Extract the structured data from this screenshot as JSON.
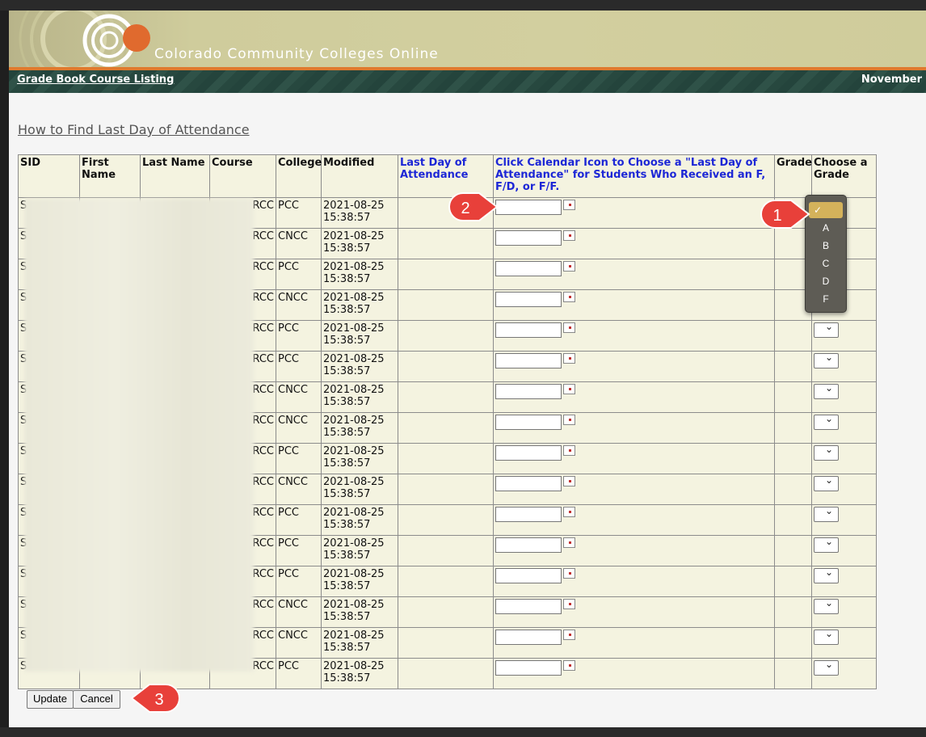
{
  "banner": {
    "site_title": "Colorado Community Colleges Online"
  },
  "nav": {
    "link": "Grade Book Course Listing",
    "date": "November"
  },
  "help_link": "How to Find Last Day of Attendance",
  "table": {
    "headers": [
      "SID",
      "First Name",
      "Last Name",
      "Course",
      "College",
      "Modified",
      "Last Day of Attendance",
      "Click Calendar Icon to Choose a \"Last Day of Attendance\" for Students Who Received an F, F/D, or F/F.",
      "Grade",
      "Choose a Grade"
    ],
    "rows": [
      {
        "sid": "S",
        "course": "RCC",
        "college": "PCC",
        "modified_date": "2021-08-25",
        "modified_time": "15:38:57"
      },
      {
        "sid": "S",
        "course": "RCC",
        "college": "CNCC",
        "modified_date": "2021-08-25",
        "modified_time": "15:38:57"
      },
      {
        "sid": "S",
        "course": "RCC",
        "college": "PCC",
        "modified_date": "2021-08-25",
        "modified_time": "15:38:57"
      },
      {
        "sid": "S",
        "course": "RCC",
        "college": "CNCC",
        "modified_date": "2021-08-25",
        "modified_time": "15:38:57"
      },
      {
        "sid": "S",
        "course": "RCC",
        "college": "PCC",
        "modified_date": "2021-08-25",
        "modified_time": "15:38:57"
      },
      {
        "sid": "S",
        "course": "RCC",
        "college": "PCC",
        "modified_date": "2021-08-25",
        "modified_time": "15:38:57"
      },
      {
        "sid": "S",
        "course": "RCC",
        "college": "CNCC",
        "modified_date": "2021-08-25",
        "modified_time": "15:38:57"
      },
      {
        "sid": "S",
        "course": "RCC",
        "college": "CNCC",
        "modified_date": "2021-08-25",
        "modified_time": "15:38:57"
      },
      {
        "sid": "S",
        "course": "RCC",
        "college": "PCC",
        "modified_date": "2021-08-25",
        "modified_time": "15:38:57"
      },
      {
        "sid": "S",
        "course": "RCC",
        "college": "CNCC",
        "modified_date": "2021-08-25",
        "modified_time": "15:38:57"
      },
      {
        "sid": "S",
        "course": "RCC",
        "college": "PCC",
        "modified_date": "2021-08-25",
        "modified_time": "15:38:57"
      },
      {
        "sid": "S",
        "course": "RCC",
        "college": "PCC",
        "modified_date": "2021-08-25",
        "modified_time": "15:38:57"
      },
      {
        "sid": "S",
        "course": "RCC",
        "college": "PCC",
        "modified_date": "2021-08-25",
        "modified_time": "15:38:57"
      },
      {
        "sid": "S",
        "course": "RCC",
        "college": "CNCC",
        "modified_date": "2021-08-25",
        "modified_time": "15:38:57"
      },
      {
        "sid": "S",
        "course": "RCC",
        "college": "CNCC",
        "modified_date": "2021-08-25",
        "modified_time": "15:38:57"
      },
      {
        "sid": "S",
        "course": "RCC",
        "college": "PCC",
        "modified_date": "2021-08-25",
        "modified_time": "15:38:57"
      }
    ]
  },
  "grade_dropdown": {
    "selected": "✓",
    "options": [
      "A",
      "B",
      "C",
      "D",
      "F"
    ]
  },
  "markers": {
    "m1": "1",
    "m2": "2",
    "m3": "3"
  },
  "buttons": {
    "update": "Update",
    "cancel": "Cancel"
  },
  "colors": {
    "banner": "#cfcc9c",
    "accent_orange": "#e07a2e",
    "nav_dark_green": "#24443c",
    "header_blue": "#1d27d6",
    "row_bg": "#f4f3e0",
    "marker_red": "#e8403a"
  }
}
